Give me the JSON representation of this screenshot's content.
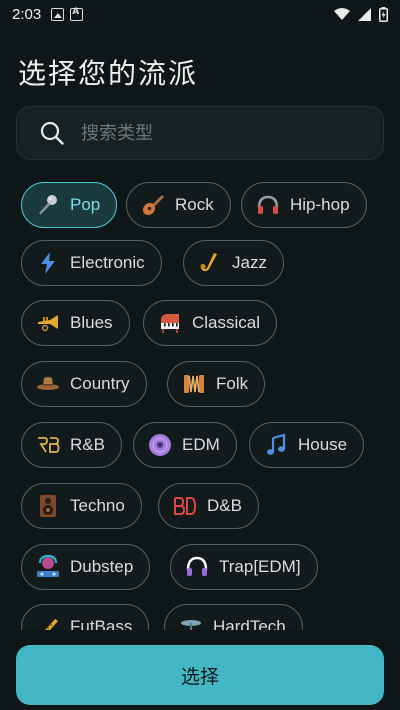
{
  "status_bar": {
    "time": "2:03"
  },
  "page": {
    "title": "选择您的流派"
  },
  "search": {
    "placeholder": "搜索类型"
  },
  "genres": [
    {
      "label": "Pop",
      "icon": "microphone-icon",
      "selected": true
    },
    {
      "label": "Rock",
      "icon": "guitar-icon",
      "selected": false
    },
    {
      "label": "Hip-hop",
      "icon": "headphones-icon",
      "selected": false
    },
    {
      "label": "Electronic",
      "icon": "lightning-icon",
      "selected": false
    },
    {
      "label": "Jazz",
      "icon": "saxophone-icon",
      "selected": false
    },
    {
      "label": "Blues",
      "icon": "trumpet-icon",
      "selected": false
    },
    {
      "label": "Classical",
      "icon": "piano-icon",
      "selected": false
    },
    {
      "label": "Country",
      "icon": "cowboy-hat-icon",
      "selected": false
    },
    {
      "label": "Folk",
      "icon": "accordion-icon",
      "selected": false
    },
    {
      "label": "R&B",
      "icon": "rb-logo-icon",
      "selected": false
    },
    {
      "label": "EDM",
      "icon": "vinyl-disc-icon",
      "selected": false
    },
    {
      "label": "House",
      "icon": "music-note-icon",
      "selected": false
    },
    {
      "label": "Techno",
      "icon": "speaker-icon",
      "selected": false
    },
    {
      "label": "D&B",
      "icon": "bd-logo-icon",
      "selected": false
    },
    {
      "label": "Dubstep",
      "icon": "dj-icon",
      "selected": false
    },
    {
      "label": "Trap[EDM]",
      "icon": "headset-icon",
      "selected": false
    },
    {
      "label": "FutBass",
      "icon": "flute-icon",
      "selected": false
    },
    {
      "label": "HardTech",
      "icon": "cymbal-icon",
      "selected": false
    }
  ],
  "actions": {
    "select_label": "选择"
  },
  "colors": {
    "background": "#0f1617",
    "accent": "#43b8c4",
    "selected_chip_border": "#4fc4cf",
    "chip_border": "#55605f"
  }
}
